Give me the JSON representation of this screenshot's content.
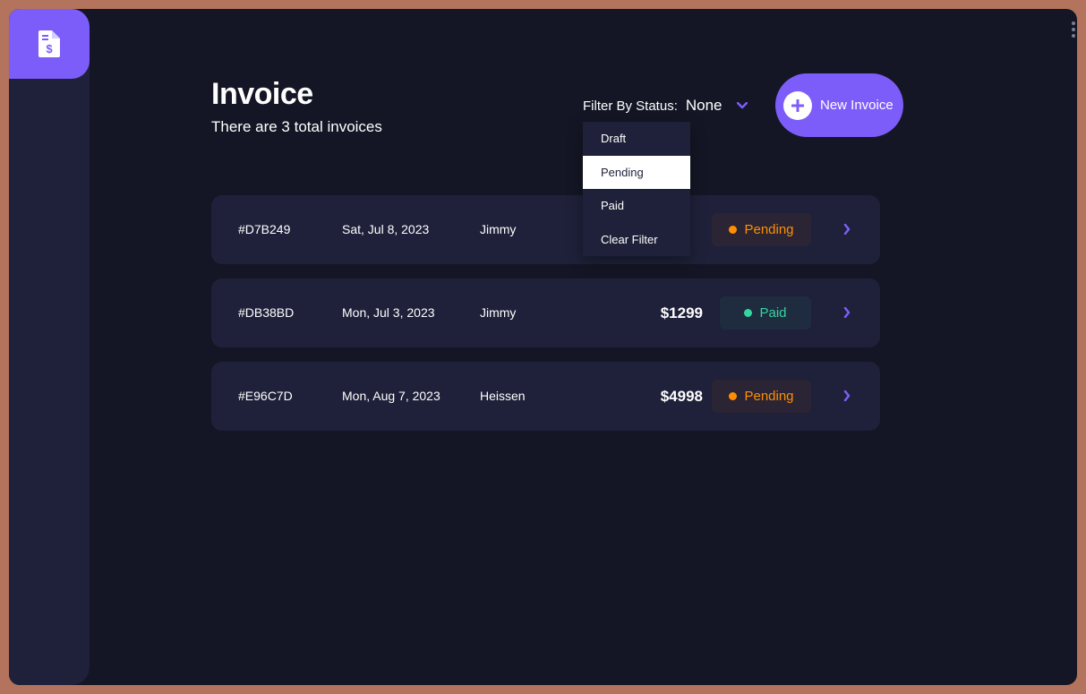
{
  "header": {
    "title": "Invoice",
    "subtitle": "There are 3 total invoices"
  },
  "filter": {
    "label": "Filter By Status:",
    "value": "None",
    "options": [
      "Draft",
      "Pending",
      "Paid",
      "Clear Filter"
    ],
    "highlighted": "Pending"
  },
  "new_invoice": {
    "label": "New Invoice"
  },
  "invoices": [
    {
      "id": "#D7B249",
      "date": "Sat, Jul 8, 2023",
      "client": "Jimmy",
      "amount": "",
      "status": "Pending"
    },
    {
      "id": "#DB38BD",
      "date": "Mon, Jul 3, 2023",
      "client": "Jimmy",
      "amount": "$1299",
      "status": "Paid"
    },
    {
      "id": "#E96C7D",
      "date": "Mon, Aug 7, 2023",
      "client": "Heissen",
      "amount": "$4998",
      "status": "Pending"
    }
  ],
  "icons": {
    "logo": "invoice-dollar-icon",
    "filter_chevron": "chevron-down-icon",
    "new_invoice": "plus-icon",
    "row_arrow": "chevron-right-icon"
  },
  "colors": {
    "accent": "#7c5dfa",
    "background": "#141625",
    "surface": "#1e2139",
    "pending": "#ff8f00",
    "paid": "#33d69f"
  }
}
